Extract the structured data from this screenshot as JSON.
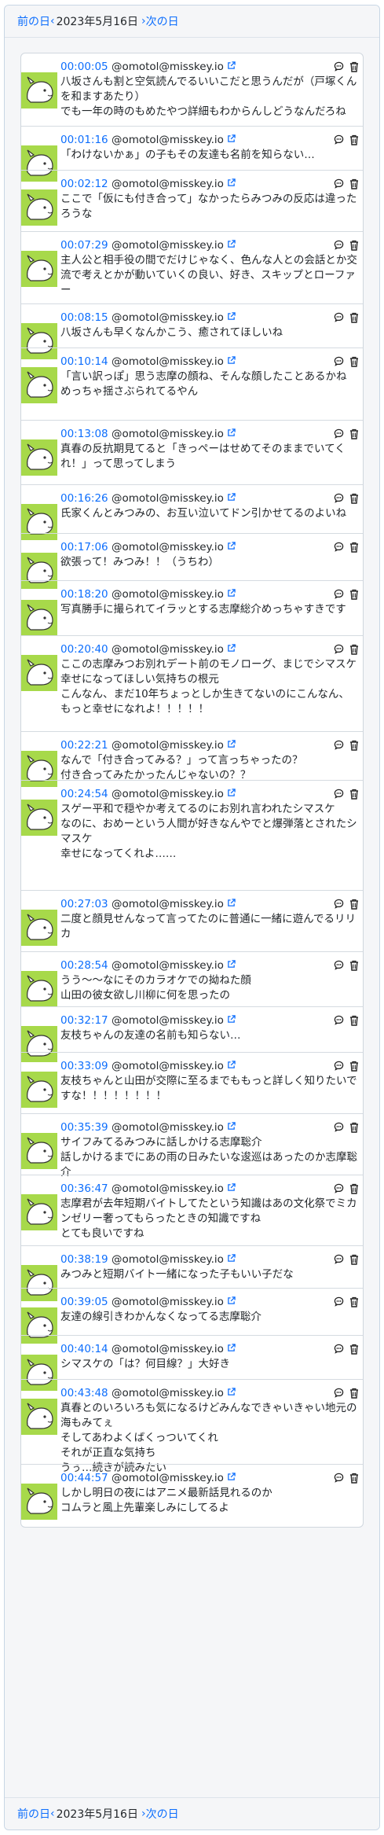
{
  "nav": {
    "prev_label": "前の日",
    "date": "2023年5月16日",
    "next_label": "次の日"
  },
  "posts": [
    {
      "time": "00:00:05",
      "user": "@omotol@misskey.io",
      "lines": [
        "八坂さんも割と空気読んでるいいこだと思うんだが（戸塚くんを和ますあたり）",
        "でも一年の時のもめたやつ詳細もわからんしどうなんだろね"
      ]
    },
    {
      "time": "00:01:16",
      "user": "@omotol@misskey.io",
      "lines": [
        "「わけないかぁ」の子もその友達も名前を知らない…"
      ]
    },
    {
      "time": "00:02:12",
      "user": "@omotol@misskey.io",
      "lines": [
        "ここで「仮にも付き合って」なかったらみつみの反応は違ったろうな"
      ]
    },
    {
      "time": "00:07:29",
      "user": "@omotol@misskey.io",
      "lines": [
        "主人公と相手役の間でだけじゃなく、色んな人との会話とか交流で考えとかが動いていくの良い、好き、スキップとローファー"
      ]
    },
    {
      "time": "00:08:15",
      "user": "@omotol@misskey.io",
      "lines": [
        "八坂さんも早くなんかこう、癒されてほしいね"
      ]
    },
    {
      "time": "00:10:14",
      "user": "@omotol@misskey.io",
      "lines": [
        "「言い訳っぽ」思う志摩の顔ね、そんな顔したことあるかね",
        "めっちゃ揺さぶられてるやん"
      ]
    },
    {
      "time": "00:13:08",
      "user": "@omotol@misskey.io",
      "lines": [
        "真春の反抗期見てると「きっぺーはせめてそのままでいてくれ！」って思ってしまう"
      ]
    },
    {
      "time": "00:16:26",
      "user": "@omotol@misskey.io",
      "lines": [
        "氏家くんとみつみの、お互い泣いてドン引かせてるのよいね"
      ]
    },
    {
      "time": "00:17:06",
      "user": "@omotol@misskey.io",
      "lines": [
        "欲張って！みつみ！！（うちわ）"
      ]
    },
    {
      "time": "00:18:20",
      "user": "@omotol@misskey.io",
      "lines": [
        "写真勝手に撮られてイラッとする志摩総介めっちゃすきです"
      ]
    },
    {
      "time": "00:20:40",
      "user": "@omotol@misskey.io",
      "lines": [
        "ここの志摩みつお別れデート前のモノローグ、まじでシマスケ幸せになってほしい気持ちの根元",
        "こんなん、まだ10年ちょっとしか生きてないのにこんなん、もっと幸せになれよ！！！！！"
      ]
    },
    {
      "time": "00:22:21",
      "user": "@omotol@misskey.io",
      "lines": [
        "なんで「付き合ってみる？」って言っちゃったの？",
        "付き合ってみたかったんじゃないの？？"
      ]
    },
    {
      "time": "00:24:54",
      "user": "@omotol@misskey.io",
      "lines": [
        "スゲー平和で穏やか考えてるのにお別れ言われたシマスケ",
        "なのに、おめーという人間が好きなんやでと爆弾落とされたシマスケ",
        "幸せになってくれよ……"
      ]
    },
    {
      "time": "00:27:03",
      "user": "@omotol@misskey.io",
      "lines": [
        "二度と顔見せんなって言ってたのに普通に一緒に遊んでるリリカ"
      ]
    },
    {
      "time": "00:28:54",
      "user": "@omotol@misskey.io",
      "lines": [
        "うう～～なにそのカラオケでの拗ねた顔",
        "山田の彼女欲し川柳に何を思ったの"
      ]
    },
    {
      "time": "00:32:17",
      "user": "@omotol@misskey.io",
      "lines": [
        "友枝ちゃんの友達の名前も知らない…"
      ]
    },
    {
      "time": "00:33:09",
      "user": "@omotol@misskey.io",
      "lines": [
        "友枝ちゃんと山田が交際に至るまでももっと詳しく知りたいですな！！！！！！！！"
      ]
    },
    {
      "time": "00:35:39",
      "user": "@omotol@misskey.io",
      "lines": [
        "サイフみてるみつみに話しかける志摩聡介",
        "話しかけるまでにあの雨の日みたいな逡巡はあったのか志摩聡介"
      ]
    },
    {
      "time": "00:36:47",
      "user": "@omotol@misskey.io",
      "lines": [
        "志摩君が去年短期バイトしてたという知識はあの文化祭でミカンゼリー奢ってもらったときの知識ですね",
        "とても良いですね"
      ]
    },
    {
      "time": "00:38:19",
      "user": "@omotol@misskey.io",
      "lines": [
        "みつみと短期バイト一緒になった子もいい子だな"
      ]
    },
    {
      "time": "00:39:05",
      "user": "@omotol@misskey.io",
      "lines": [
        "友達の線引きわかんなくなってる志摩聡介"
      ]
    },
    {
      "time": "00:40:14",
      "user": "@omotol@misskey.io",
      "lines": [
        "シマスケの「は？何目線？」大好き"
      ]
    },
    {
      "time": "00:43:48",
      "user": "@omotol@misskey.io",
      "lines": [
        "真春とのいろいろも気になるけどみんなできゃいきゃい地元の海もみてぇ",
        "そしてあわよくばくっついてくれ",
        "それが正直な気持ち",
        "うぅ…続きが読みたい"
      ]
    },
    {
      "time": "00:44:57",
      "user": "@omotol@misskey.io",
      "lines": [
        "しかし明日の夜にはアニメ最新話見れるのか",
        "コムラと風上先輩楽しみにしてるよ"
      ]
    }
  ]
}
